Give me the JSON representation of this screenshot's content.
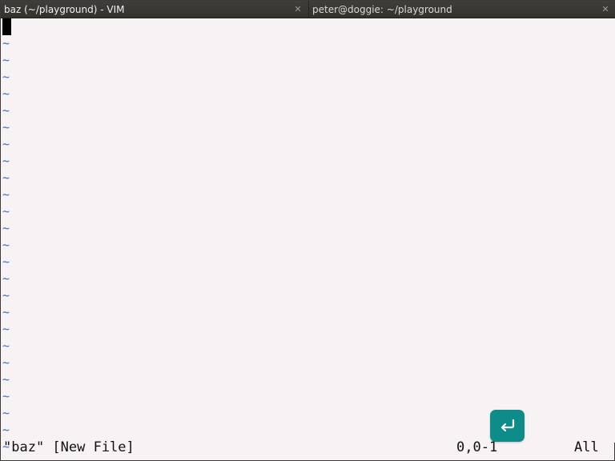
{
  "tabs": [
    {
      "label": "baz (~/playground) - VIM",
      "active": true,
      "close_icon": "close-icon"
    },
    {
      "label": "peter@doggie: ~/playground",
      "active": false,
      "close_icon": "close-icon"
    }
  ],
  "editor": {
    "empty_line_marker": "~",
    "empty_line_count": 25
  },
  "status": {
    "file_message": "\"baz\" [New File]",
    "cursor_position": "0,0-1",
    "scroll_position": "All"
  },
  "overlay": {
    "enter_button_icon": "enter-icon",
    "enter_button_color": "#0e8c8a"
  },
  "colors": {
    "tilde": "#3f6fc2",
    "background": "#f7f2f3",
    "tabbar": "#3b3a36"
  }
}
